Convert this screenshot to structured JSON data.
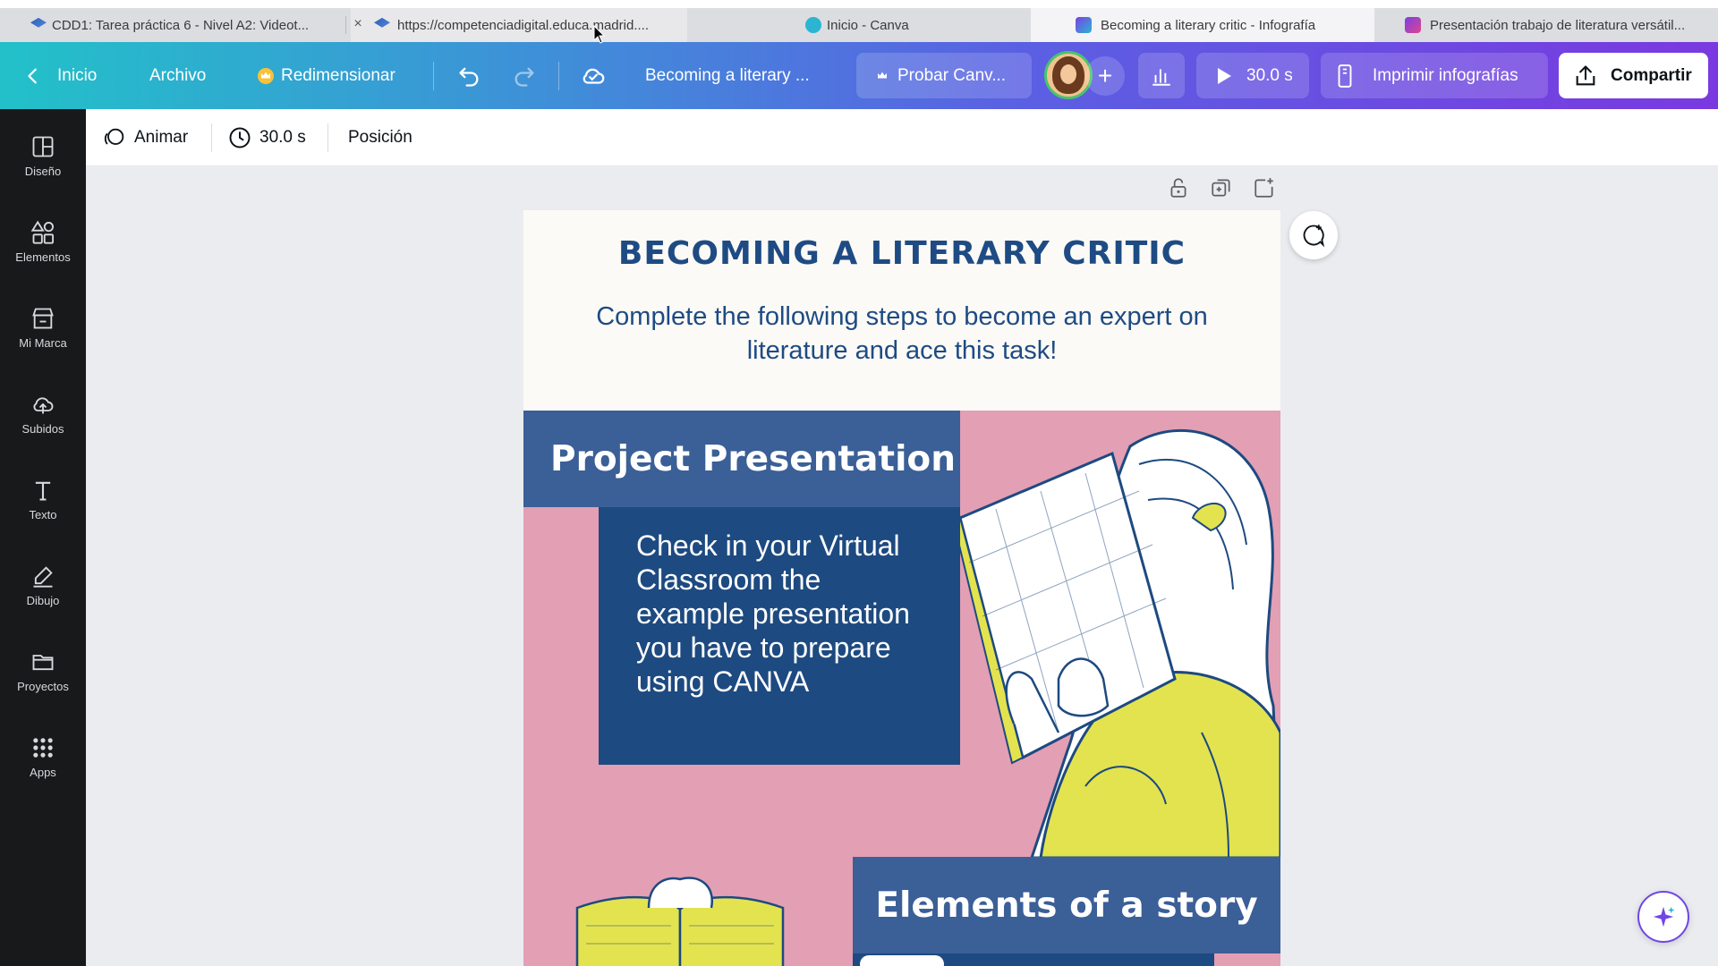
{
  "browser": {
    "tabs": [
      {
        "label": "CDD1: Tarea práctica 6 - Nivel A2: Videot...",
        "icon": "graduation-cap-icon"
      },
      {
        "label": "https://competenciadigital.educa.madrid....",
        "icon": "graduation-cap-icon"
      },
      {
        "label": "Inicio - Canva",
        "icon": "canva-icon"
      },
      {
        "label": "Becoming a literary critic - Infografía",
        "icon": "infographic-icon"
      },
      {
        "label": "Presentación trabajo de literatura versátil...",
        "icon": "presentation-icon"
      }
    ],
    "close_glyph": "×"
  },
  "header": {
    "back_label": "Inicio",
    "file_label": "Archivo",
    "resize_label": "Redimensionar",
    "doc_title": "Becoming a literary ...",
    "try_label": "Probar Canv...",
    "add_glyph": "+",
    "play_duration": "30.0 s",
    "print_label": "Imprimir infografías",
    "share_label": "Compartir"
  },
  "sidebar": {
    "items": [
      {
        "label": "Diseño",
        "icon": "layout-icon"
      },
      {
        "label": "Elementos",
        "icon": "elements-icon"
      },
      {
        "label": "Mi Marca",
        "icon": "brand-icon"
      },
      {
        "label": "Subidos",
        "icon": "cloud-upload-icon"
      },
      {
        "label": "Texto",
        "icon": "text-icon"
      },
      {
        "label": "Dibujo",
        "icon": "draw-icon"
      },
      {
        "label": "Proyectos",
        "icon": "folder-icon"
      },
      {
        "label": "Apps",
        "icon": "apps-grid-icon"
      }
    ]
  },
  "toolbar": {
    "animate_label": "Animar",
    "duration_label": "30.0 s",
    "position_label": "Posición"
  },
  "design": {
    "title": "BECOMING A LITERARY CRITIC",
    "subtitle": "Complete the following steps to become an expert on literature and ace this task!",
    "section1_title": "Project Presentation",
    "section1_body": "Check in your Virtual Classroom the example presentation you have to prepare using CANVA",
    "section2_title": "Elements of a story",
    "colors": {
      "navy": "#1d4a80",
      "blue": "#3b5f97",
      "pink": "#e39fb4",
      "cream": "#fcfaf6",
      "yellow": "#e3e34f",
      "title_blue": "#1e4b84"
    }
  }
}
